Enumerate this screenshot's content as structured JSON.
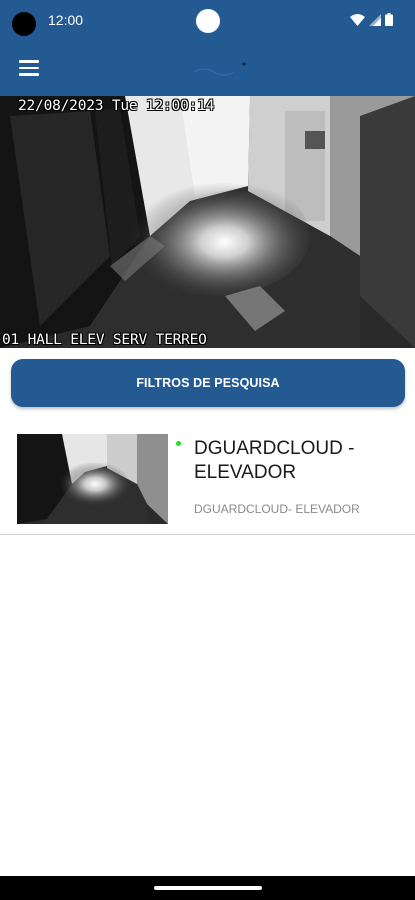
{
  "status_bar": {
    "time": "12:00",
    "icons": [
      "wifi-icon",
      "signal-icon",
      "battery-icon"
    ]
  },
  "app_bar": {
    "menu_icon": "hamburger-menu-icon",
    "logo": "app-logo"
  },
  "camera_feed": {
    "osd_timestamp": "22/08/2023 Tue 12:00:14",
    "osd_camera_name": "01 HALL ELEV SERV TERREO"
  },
  "filter_button": {
    "label": "FILTROS DE PESQUISA"
  },
  "camera_list": [
    {
      "title": "DGUARDCLOUD - ELEVADOR",
      "subtitle": "DGUARDCLOUD- ELEVADOR",
      "status": "online",
      "status_color": "#22dd22"
    }
  ],
  "colors": {
    "primary": "#235a92",
    "divider": "#cfcfcf"
  }
}
